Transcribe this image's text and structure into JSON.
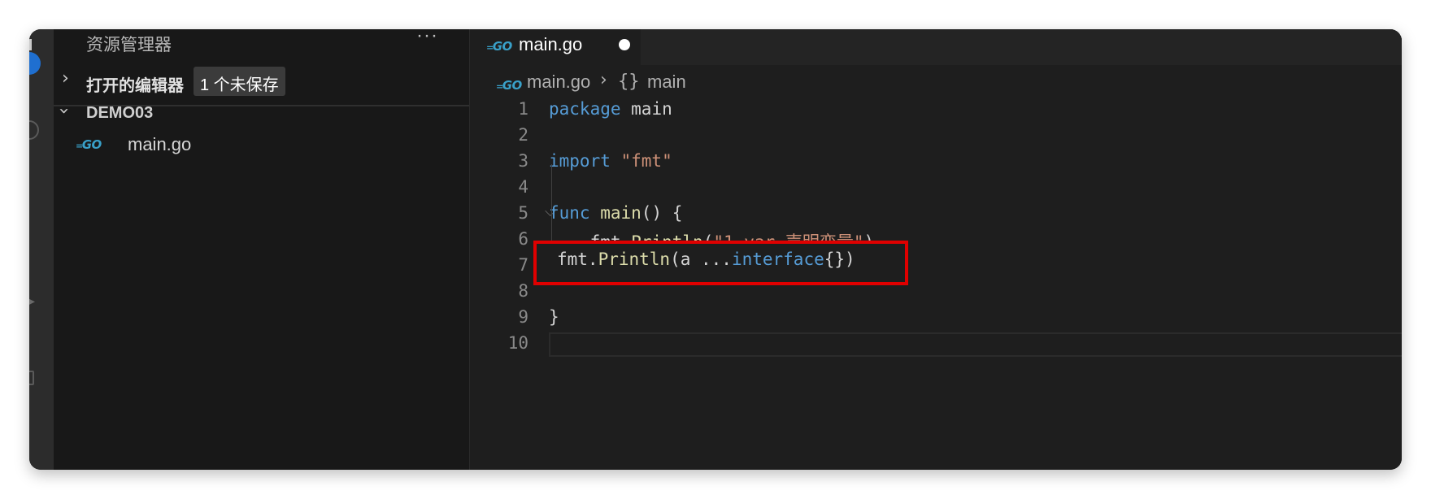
{
  "sidebar": {
    "title": "资源管理器",
    "more_label": "···",
    "open_editors": {
      "label": "打开的编辑器",
      "badge": "1 个未保存"
    },
    "folder": {
      "label": "DEMO03",
      "files": [
        {
          "name": "main.go",
          "icon": "go-file-icon"
        }
      ]
    }
  },
  "tab": {
    "label": "main.go",
    "icon_text": "GO",
    "dirty": true
  },
  "breadcrumb": {
    "file": "main.go",
    "separator": "›",
    "symbol_icon": "{}",
    "symbol": "main"
  },
  "code": {
    "line_numbers": [
      "1",
      "2",
      "3",
      "4",
      "5",
      "6",
      "7",
      "8",
      "9",
      "10"
    ],
    "line1": {
      "kw": "package",
      "rest": " main"
    },
    "line3": {
      "kw": "import",
      "str": " \"fmt\""
    },
    "line5": {
      "kw": "func",
      "fn": " main",
      "rest": "() {"
    },
    "line6": {
      "obj": "    fmt.",
      "fn": "Println",
      "open": "(",
      "str": "\"1 var 声明变量\"",
      "close": ")"
    },
    "line9": {
      "rest": "}"
    }
  },
  "hint_box": {
    "obj": "fmt.",
    "fn": "Println",
    "args": "(a ...",
    "kw": "interface",
    "tail": "{})"
  },
  "colors": {
    "keyword": "#569cd6",
    "string": "#ce9178",
    "function": "#dcdcaa",
    "highlight_border": "#e00000",
    "go_icon": "#39a0c8"
  }
}
